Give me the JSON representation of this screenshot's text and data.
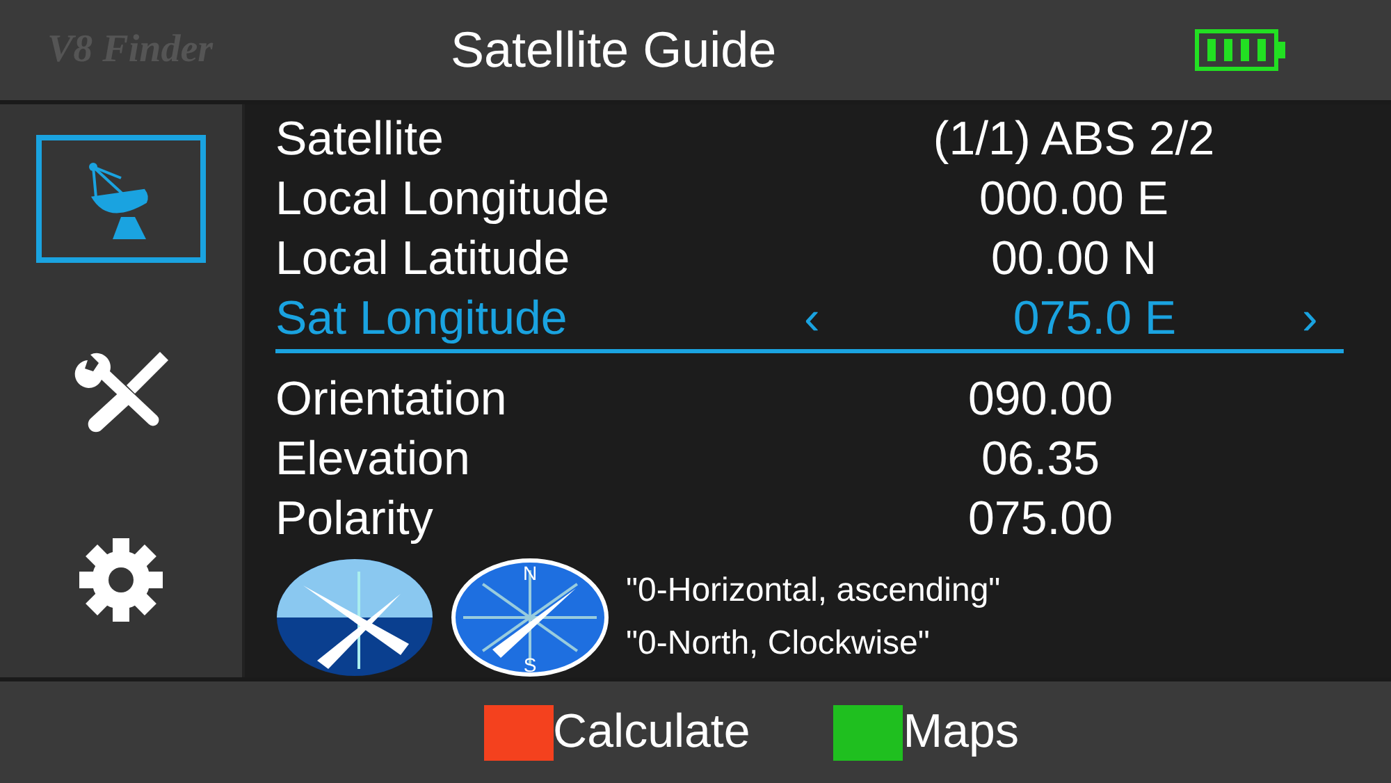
{
  "header": {
    "logo": "V8 Finder",
    "title": "Satellite Guide"
  },
  "sidebar": {
    "items": [
      {
        "kind": "dish",
        "selected": true
      },
      {
        "kind": "tools",
        "selected": false
      },
      {
        "kind": "gear",
        "selected": false
      }
    ]
  },
  "fields": [
    {
      "label": "Satellite",
      "value": "(1/1) ABS 2/2",
      "selected": false
    },
    {
      "label": "Local Longitude",
      "value": "000.00 E",
      "selected": false
    },
    {
      "label": "Local Latitude",
      "value": "00.00 N",
      "selected": false
    },
    {
      "label": "Sat Longitude",
      "value": "075.0 E",
      "selected": true,
      "prev": "‹",
      "next": "›"
    }
  ],
  "results": [
    {
      "label": "Orientation",
      "value": "090.00"
    },
    {
      "label": "Elevation",
      "value": "06.35"
    },
    {
      "label": "Polarity",
      "value": "075.00"
    }
  ],
  "legend": {
    "compass_north": "N",
    "compass_south": "S",
    "notes": [
      "\"0-Horizontal, ascending\"",
      "\"0-North, Clockwise\""
    ]
  },
  "footer": {
    "buttons": [
      {
        "label": "Calculate",
        "color": "#f4411e"
      },
      {
        "label": "Maps",
        "color": "#1fbf1f"
      }
    ]
  }
}
